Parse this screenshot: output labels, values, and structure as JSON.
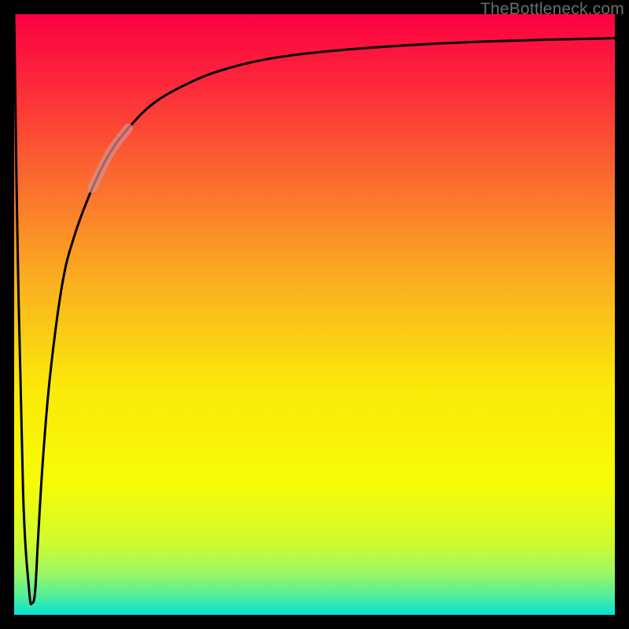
{
  "watermark": {
    "text": "TheBottleneck.com"
  },
  "colors": {
    "frame": "#000000",
    "curve": "#000000",
    "highlight": "#d98f8c",
    "gradient_stops": [
      {
        "offset": 0.0,
        "color": "#fb0040"
      },
      {
        "offset": 0.12,
        "color": "#fc2a3a"
      },
      {
        "offset": 0.28,
        "color": "#fb6d2e"
      },
      {
        "offset": 0.45,
        "color": "#fbb11f"
      },
      {
        "offset": 0.62,
        "color": "#fbe90a"
      },
      {
        "offset": 0.78,
        "color": "#f6fc05"
      },
      {
        "offset": 0.88,
        "color": "#d0fb2f"
      },
      {
        "offset": 0.93,
        "color": "#9cf763"
      },
      {
        "offset": 0.97,
        "color": "#4fed9e"
      },
      {
        "offset": 1.0,
        "color": "#06e1d6"
      }
    ]
  },
  "chart_data": {
    "type": "line",
    "title": "",
    "xlabel": "",
    "ylabel": "",
    "xlim": [
      0,
      100
    ],
    "ylim": [
      0,
      100
    ],
    "series": [
      {
        "name": "bottleneck-curve",
        "x": [
          0.0,
          0.6,
          1.5,
          2.5,
          3.0,
          3.5,
          4.0,
          4.8,
          6.0,
          8.0,
          10.0,
          13.0,
          16.0,
          19.0,
          23.0,
          28.0,
          34.0,
          42.0,
          52.0,
          65.0,
          80.0,
          100.0
        ],
        "y": [
          100.0,
          60.0,
          20.0,
          4.0,
          2.0,
          4.0,
          13.0,
          26.0,
          40.0,
          55.0,
          63.0,
          71.0,
          77.0,
          81.0,
          85.0,
          88.0,
          90.5,
          92.5,
          93.8,
          94.8,
          95.5,
          96.0
        ]
      }
    ],
    "annotations": [
      {
        "name": "curve-highlight",
        "x_range": [
          13.0,
          19.0
        ],
        "color": "#d98f8c"
      }
    ]
  }
}
